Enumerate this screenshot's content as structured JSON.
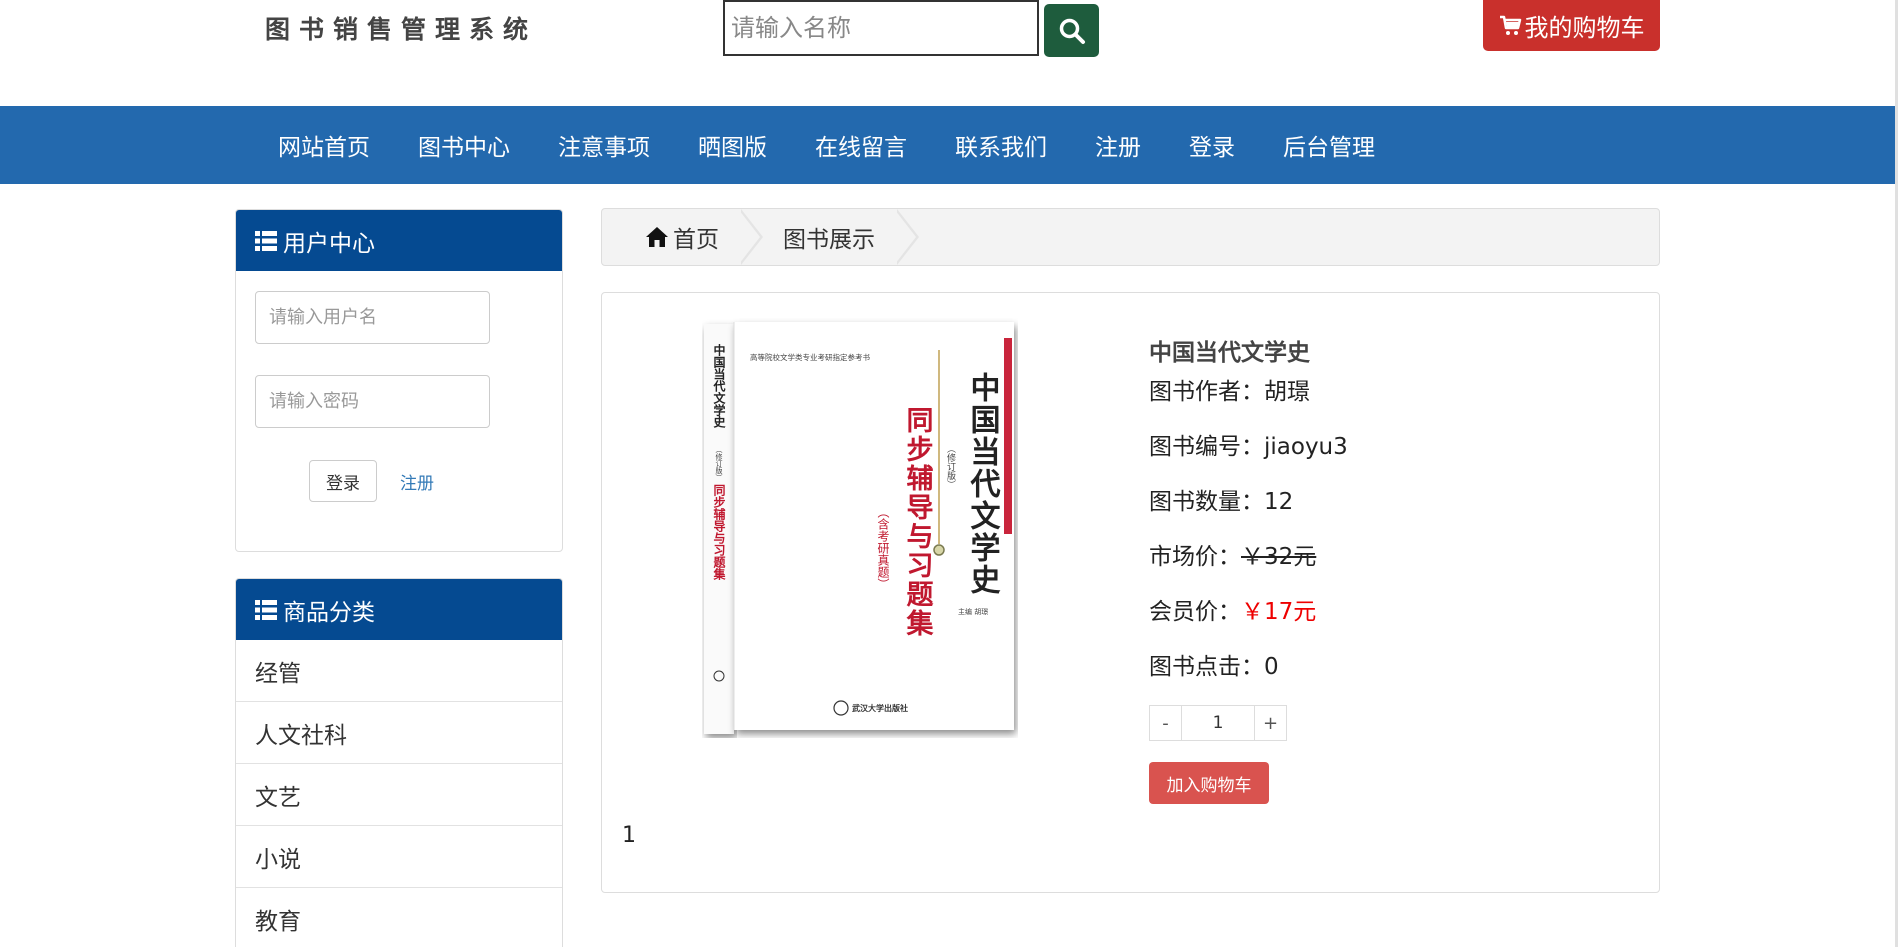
{
  "header": {
    "logo_text": "图书销售管理系统",
    "search_placeholder": "请输入名称",
    "search_icon": "search-icon",
    "cart_label": "我的购物车",
    "cart_icon": "shopping-cart-icon"
  },
  "nav": {
    "items": [
      "网站首页",
      "图书中心",
      "注意事项",
      "晒图版",
      "在线留言",
      "联系我们",
      "注册",
      "登录",
      "后台管理"
    ]
  },
  "user_center": {
    "title": "用户中心",
    "username_placeholder": "请输入用户名",
    "password_placeholder": "请输入密码",
    "login_label": "登录",
    "register_label": "注册"
  },
  "categories": {
    "title": "商品分类",
    "items": [
      "经管",
      "人文社科",
      "文艺",
      "小说",
      "教育"
    ]
  },
  "breadcrumb": {
    "home": "首页",
    "current": "图书展示"
  },
  "cover": {
    "publisher_line": "高等院校文学类专业考研指定参考书",
    "spine_title": "中国当代文学史",
    "spine_edition": "（修订版）",
    "spine_subtitle": "同步辅导与习题集",
    "main_title": "中国当代文学史",
    "edition": "（修订版）",
    "subtitle": "同步辅导与习题集",
    "note": "（含考研真题）",
    "editor": "主编 胡璟",
    "press": "武汉大学出版社"
  },
  "product": {
    "title": "中国当代文学史",
    "author_label": "图书作者：",
    "author": "胡璟",
    "code_label": "图书编号：",
    "code": "jiaoyu3",
    "count_label": "图书数量：",
    "count": "12",
    "market_label": "市场价：",
    "market_price": "￥32元",
    "member_label": "会员价：",
    "member_price": "￥17元",
    "clicks_label": "图书点击：",
    "clicks": "0",
    "qty_minus": "-",
    "qty_value": "1",
    "qty_plus": "+",
    "add_cart_label": "加入购物车",
    "page_number": "1"
  }
}
